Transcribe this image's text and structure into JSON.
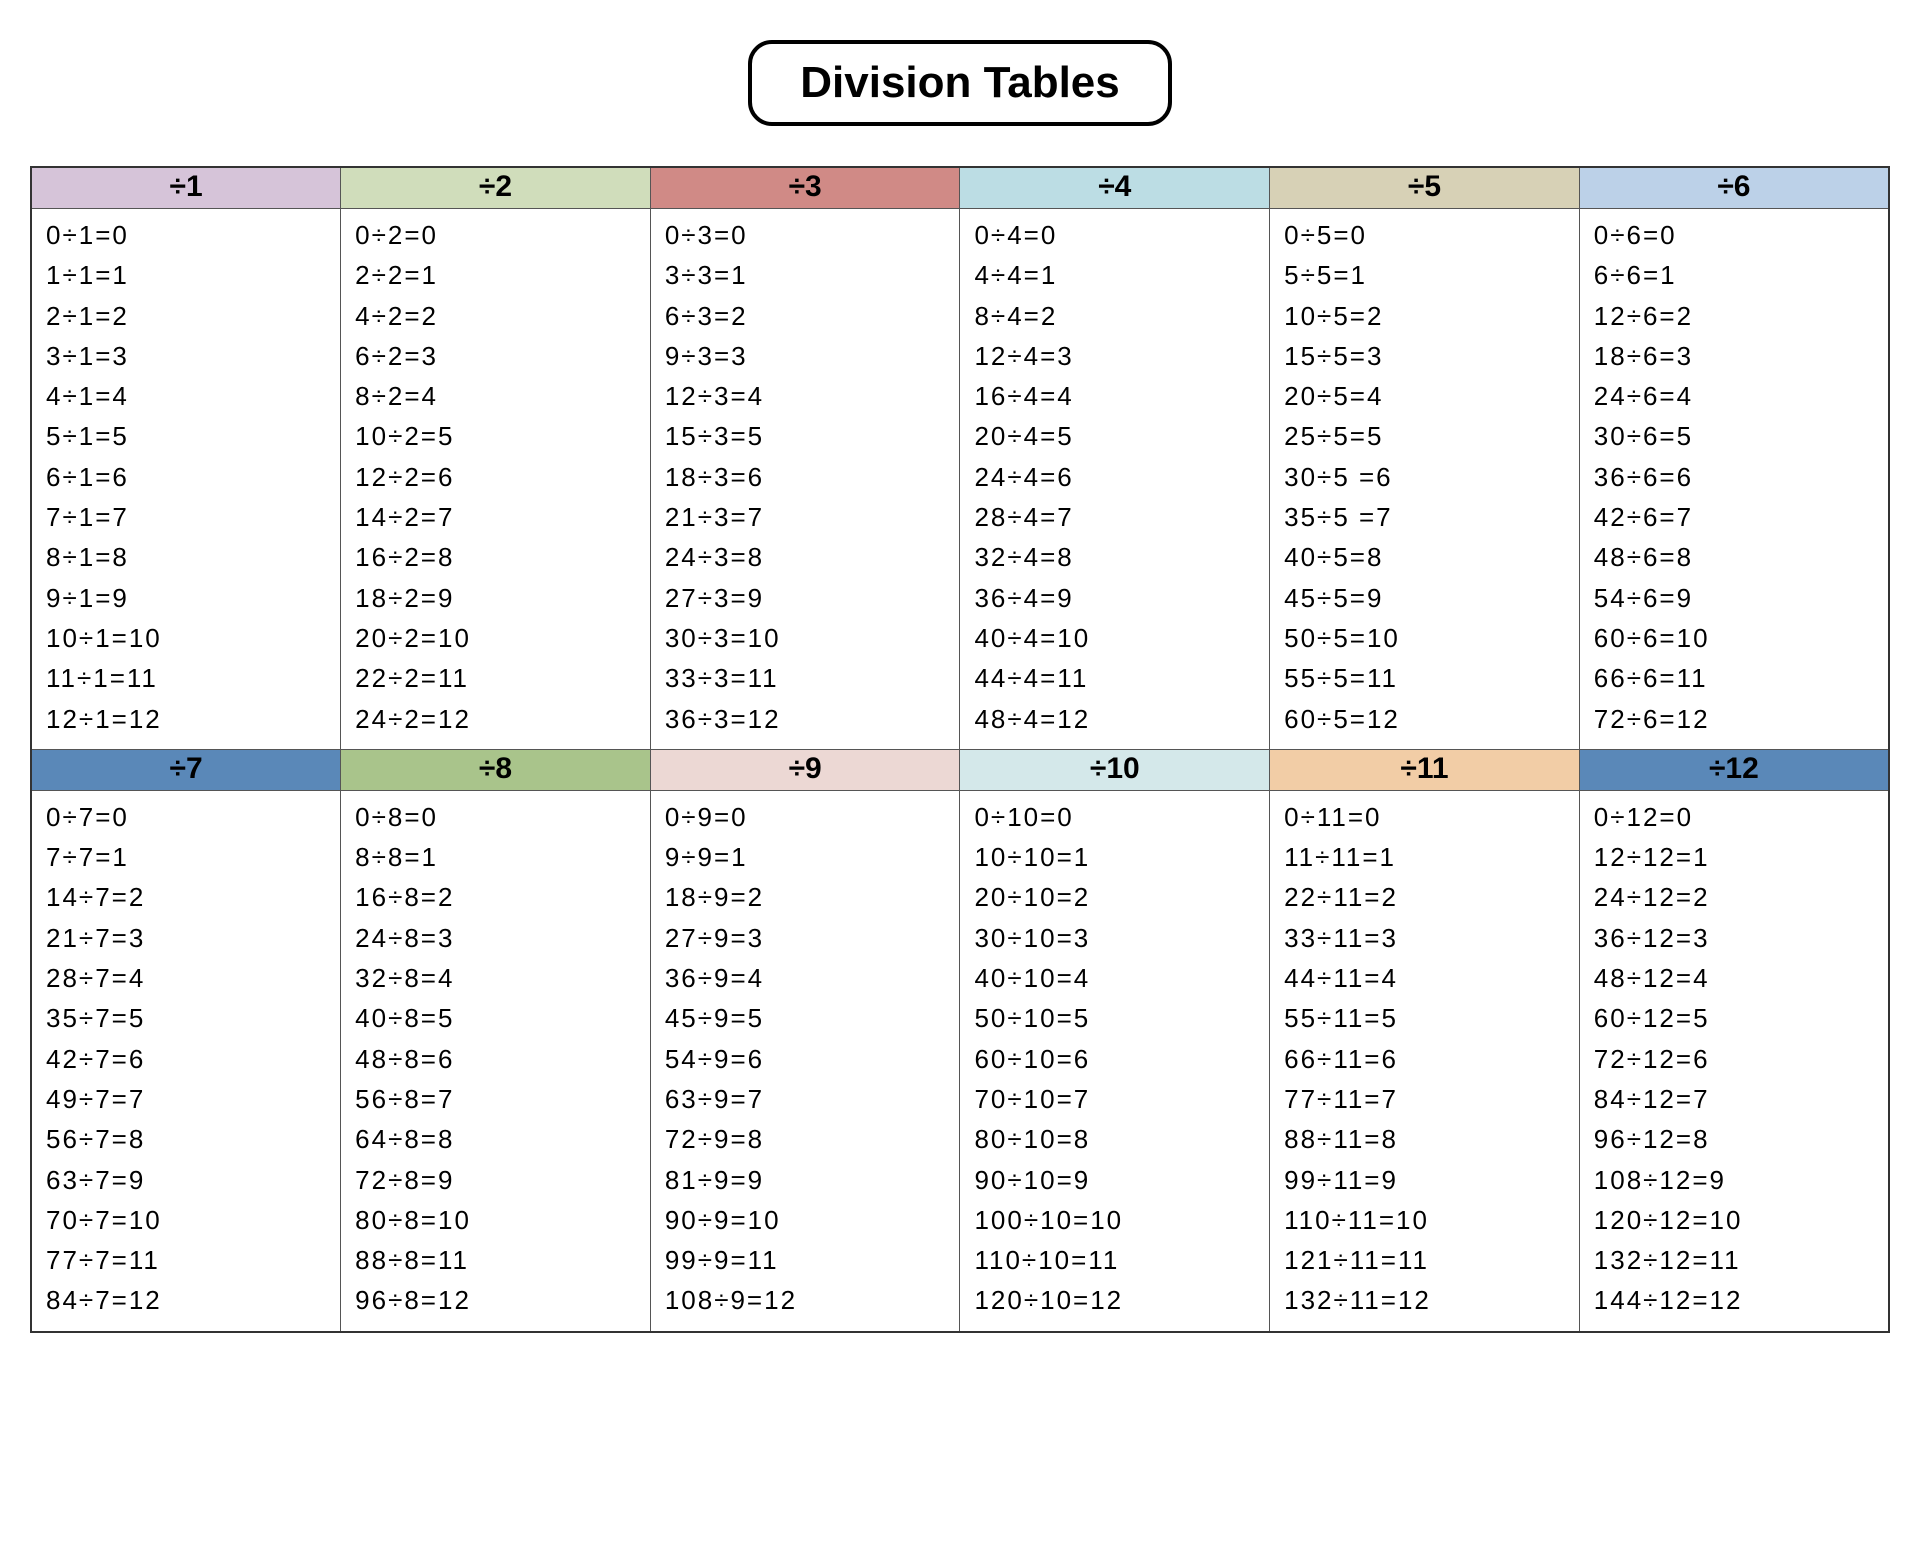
{
  "title": "Division Tables",
  "colors": {
    "c1": "#d6c4d9",
    "c2": "#d0ddbb",
    "c3": "#d08a86",
    "c4": "#bcdde4",
    "c5": "#d7d1b6",
    "c6": "#bcd1e8",
    "c7": "#5a88b8",
    "c8": "#a9c48b",
    "c9": "#ecd8d4",
    "c10": "#d4e8ea",
    "c11": "#f2cda6",
    "c12": "#5a88b8"
  },
  "tables": [
    {
      "divisor": 1,
      "head": "÷1",
      "colorKey": "c1",
      "rows": [
        "0÷1=0",
        "1÷1=1",
        "2÷1=2",
        "3÷1=3",
        "4÷1=4",
        "5÷1=5",
        "6÷1=6",
        "7÷1=7",
        "8÷1=8",
        "9÷1=9",
        "10÷1=10",
        "11÷1=11",
        "12÷1=12"
      ]
    },
    {
      "divisor": 2,
      "head": "÷2",
      "colorKey": "c2",
      "rows": [
        "0÷2=0",
        "2÷2=1",
        "4÷2=2",
        "6÷2=3",
        "8÷2=4",
        "10÷2=5",
        "12÷2=6",
        "14÷2=7",
        "16÷2=8",
        "18÷2=9",
        "20÷2=10",
        "22÷2=11",
        "24÷2=12"
      ]
    },
    {
      "divisor": 3,
      "head": "÷3",
      "colorKey": "c3",
      "rows": [
        "0÷3=0",
        "3÷3=1",
        "6÷3=2",
        "9÷3=3",
        "12÷3=4",
        "15÷3=5",
        "18÷3=6",
        "21÷3=7",
        "24÷3=8",
        "27÷3=9",
        "30÷3=10",
        "33÷3=11",
        "36÷3=12"
      ]
    },
    {
      "divisor": 4,
      "head": "÷4",
      "colorKey": "c4",
      "rows": [
        "0÷4=0",
        "4÷4=1",
        "8÷4=2",
        "12÷4=3",
        "16÷4=4",
        "20÷4=5",
        "24÷4=6",
        "28÷4=7",
        "32÷4=8",
        "36÷4=9",
        "40÷4=10",
        "44÷4=11",
        "48÷4=12"
      ]
    },
    {
      "divisor": 5,
      "head": "÷5",
      "colorKey": "c5",
      "rows": [
        "0÷5=0",
        "5÷5=1",
        "10÷5=2",
        "15÷5=3",
        "20÷5=4",
        "25÷5=5",
        "30÷5 =6",
        "35÷5 =7",
        "40÷5=8",
        "45÷5=9",
        "50÷5=10",
        "55÷5=11",
        "60÷5=12"
      ]
    },
    {
      "divisor": 6,
      "head": "÷6",
      "colorKey": "c6",
      "rows": [
        "0÷6=0",
        "6÷6=1",
        "12÷6=2",
        "18÷6=3",
        "24÷6=4",
        "30÷6=5",
        "36÷6=6",
        "42÷6=7",
        "48÷6=8",
        "54÷6=9",
        "60÷6=10",
        "66÷6=11",
        "72÷6=12"
      ]
    },
    {
      "divisor": 7,
      "head": "÷7",
      "colorKey": "c7",
      "rows": [
        "0÷7=0",
        "7÷7=1",
        "14÷7=2",
        "21÷7=3",
        "28÷7=4",
        "35÷7=5",
        "42÷7=6",
        "49÷7=7",
        "56÷7=8",
        "63÷7=9",
        "70÷7=10",
        "77÷7=11",
        "84÷7=12"
      ]
    },
    {
      "divisor": 8,
      "head": "÷8",
      "colorKey": "c8",
      "rows": [
        "0÷8=0",
        "8÷8=1",
        "16÷8=2",
        "24÷8=3",
        "32÷8=4",
        "40÷8=5",
        "48÷8=6",
        "56÷8=7",
        "64÷8=8",
        "72÷8=9",
        "80÷8=10",
        "88÷8=11",
        "96÷8=12"
      ]
    },
    {
      "divisor": 9,
      "head": "÷9",
      "colorKey": "c9",
      "rows": [
        "0÷9=0",
        "9÷9=1",
        "18÷9=2",
        "27÷9=3",
        "36÷9=4",
        "45÷9=5",
        "54÷9=6",
        "63÷9=7",
        "72÷9=8",
        "81÷9=9",
        "90÷9=10",
        "99÷9=11",
        "108÷9=12"
      ]
    },
    {
      "divisor": 10,
      "head": "÷10",
      "colorKey": "c10",
      "rows": [
        "0÷10=0",
        "10÷10=1",
        "20÷10=2",
        "30÷10=3",
        "40÷10=4",
        "50÷10=5",
        "60÷10=6",
        "70÷10=7",
        "80÷10=8",
        "90÷10=9",
        "100÷10=10",
        "110÷10=11",
        "120÷10=12"
      ]
    },
    {
      "divisor": 11,
      "head": "÷11",
      "colorKey": "c11",
      "rows": [
        "0÷11=0",
        "11÷11=1",
        "22÷11=2",
        "33÷11=3",
        "44÷11=4",
        "55÷11=5",
        "66÷11=6",
        "77÷11=7",
        "88÷11=8",
        "99÷11=9",
        "110÷11=10",
        "121÷11=11",
        "132÷11=12"
      ]
    },
    {
      "divisor": 12,
      "head": "÷12",
      "colorKey": "c12",
      "rows": [
        "0÷12=0",
        "12÷12=1",
        "24÷12=2",
        "36÷12=3",
        "48÷12=4",
        "60÷12=5",
        "72÷12=6",
        "84÷12=7",
        "96÷12=8",
        "108÷12=9",
        "120÷12=10",
        "132÷12=11",
        "144÷12=12"
      ]
    }
  ]
}
